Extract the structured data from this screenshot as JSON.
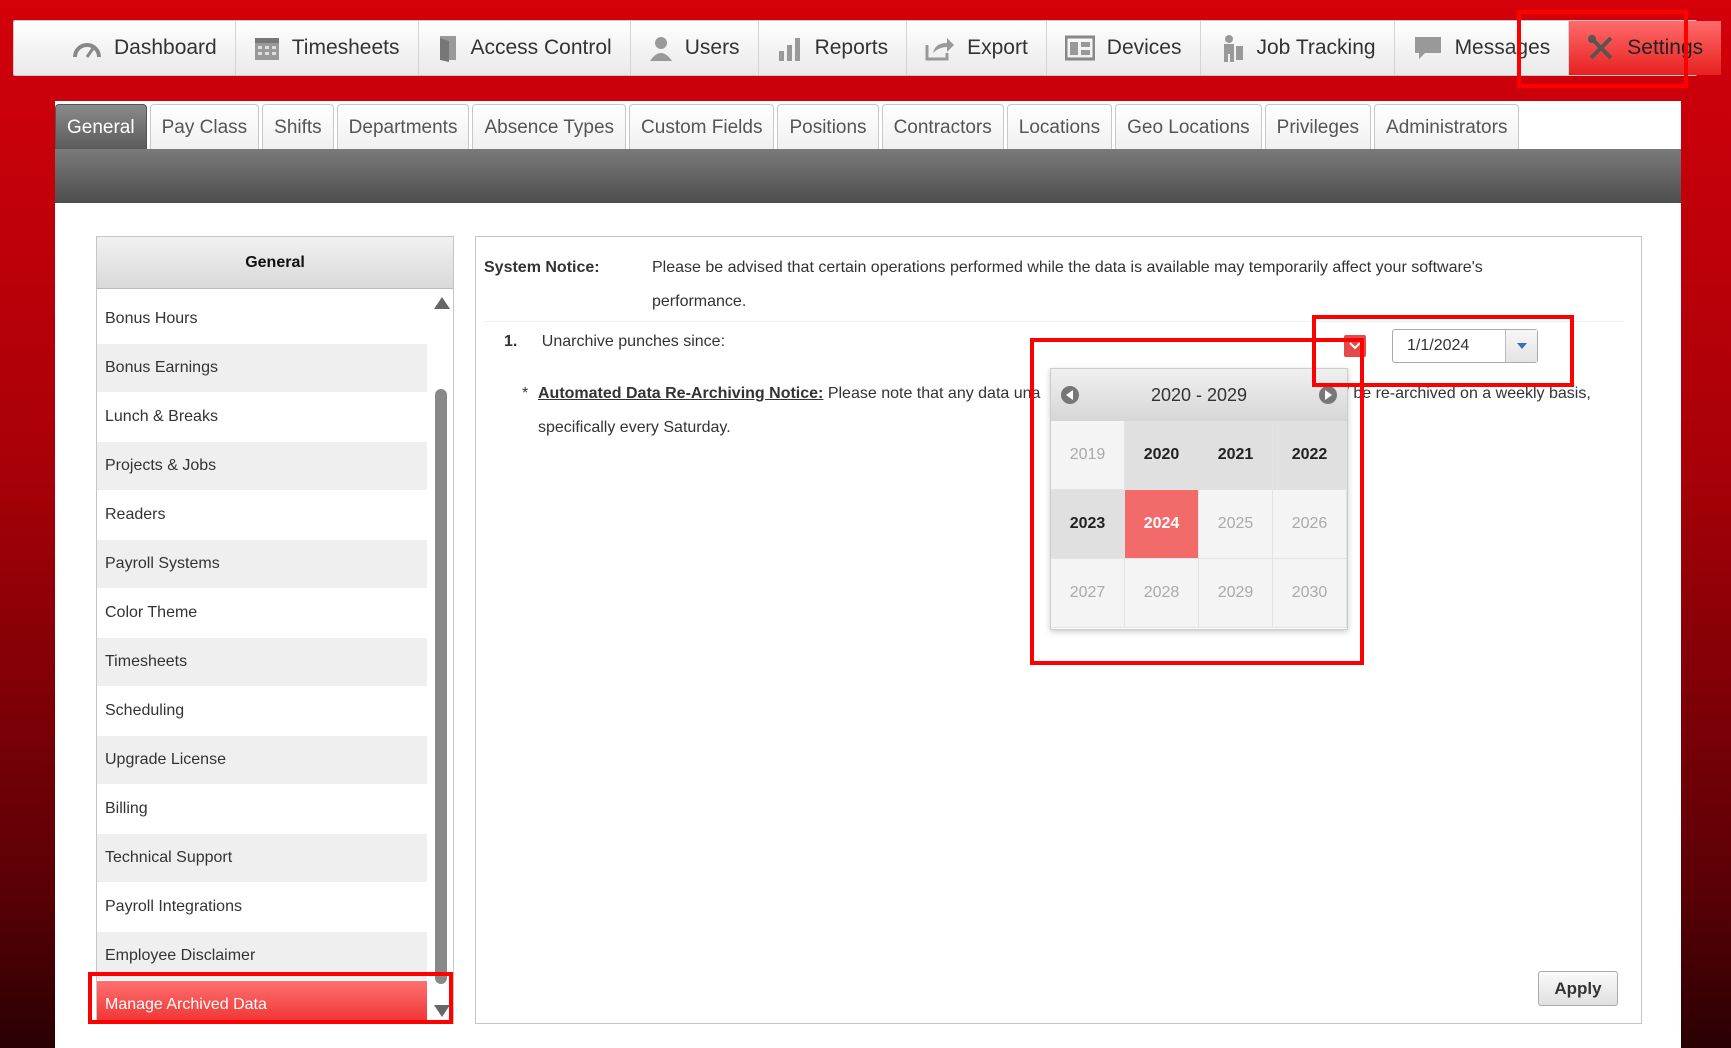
{
  "nav": {
    "items": [
      {
        "label": "Dashboard",
        "icon": "dashboard-icon"
      },
      {
        "label": "Timesheets",
        "icon": "calendar-icon"
      },
      {
        "label": "Access Control",
        "icon": "door-icon"
      },
      {
        "label": "Users",
        "icon": "user-icon"
      },
      {
        "label": "Reports",
        "icon": "bar-chart-icon"
      },
      {
        "label": "Export",
        "icon": "export-icon"
      },
      {
        "label": "Devices",
        "icon": "devices-icon"
      },
      {
        "label": "Job Tracking",
        "icon": "job-tracking-icon"
      },
      {
        "label": "Messages",
        "icon": "message-icon"
      },
      {
        "label": "Settings",
        "icon": "wrench-screwdriver-icon"
      }
    ],
    "active": "Settings"
  },
  "tabs": {
    "items": [
      "General",
      "Pay Class",
      "Shifts",
      "Departments",
      "Absence Types",
      "Custom Fields",
      "Positions",
      "Contractors",
      "Locations",
      "Geo Locations",
      "Privileges",
      "Administrators"
    ],
    "active": "General"
  },
  "sidebar": {
    "title": "General",
    "items": [
      "Bonus Hours",
      "Bonus Earnings",
      "Lunch & Breaks",
      "Projects & Jobs",
      "Readers",
      "Payroll Systems",
      "Color Theme",
      "Timesheets",
      "Scheduling",
      "Upgrade License",
      "Billing",
      "Technical Support",
      "Payroll Integrations",
      "Employee Disclaimer",
      "Manage Archived Data"
    ],
    "active": "Manage Archived Data"
  },
  "panel": {
    "notice_label": "System Notice:",
    "notice_text": "Please be advised that certain operations performed while the data is available may temporarily affect your software's performance.",
    "item_number": "1.",
    "item_label": "Unarchive punches since:",
    "date_value": "1/1/2024",
    "note_star": "*",
    "note_title": "Automated Data Re-Archiving Notice:",
    "note_text_start": "Please note that any data una",
    "note_text_end": "/ be re-archived on a weekly basis, specifically every Saturday.",
    "apply_label": "Apply"
  },
  "calendar": {
    "range_label": "2020 - 2029",
    "years": [
      {
        "y": "2019",
        "state": "out"
      },
      {
        "y": "2020",
        "state": "in"
      },
      {
        "y": "2021",
        "state": "in"
      },
      {
        "y": "2022",
        "state": "in"
      },
      {
        "y": "2023",
        "state": "in"
      },
      {
        "y": "2024",
        "state": "selected"
      },
      {
        "y": "2025",
        "state": "out"
      },
      {
        "y": "2026",
        "state": "out"
      },
      {
        "y": "2027",
        "state": "out"
      },
      {
        "y": "2028",
        "state": "out"
      },
      {
        "y": "2029",
        "state": "out"
      },
      {
        "y": "2030",
        "state": "out"
      }
    ]
  },
  "colors": {
    "accent": "#e82020",
    "highlight": "#ff0000",
    "selected_year": "#f26a6a"
  }
}
